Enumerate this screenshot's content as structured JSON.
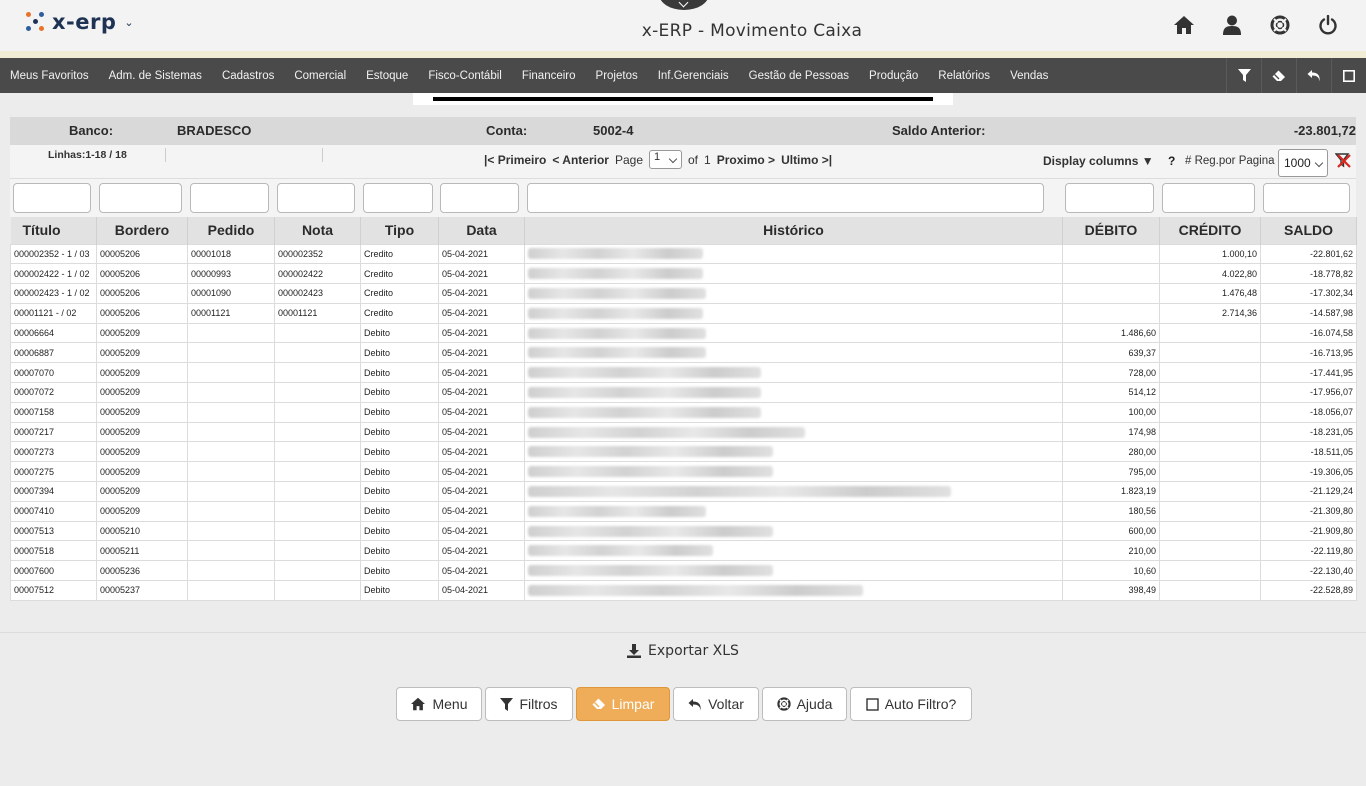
{
  "header": {
    "logo_text": "x-erp",
    "title": "x-ERP - Movimento Caixa",
    "icons": [
      "home-icon",
      "user-icon",
      "support-icon",
      "power-icon"
    ]
  },
  "menu": {
    "items": [
      "Meus Favoritos",
      "Adm. de Sistemas",
      "Cadastros",
      "Comercial",
      "Estoque",
      "Fisco-Contábil",
      "Financeiro",
      "Projetos",
      "Inf.Gerenciais",
      "Gestão de Pessoas",
      "Produção",
      "Relatórios",
      "Vendas"
    ],
    "tools": [
      "filter-icon",
      "eraser-icon",
      "undo-icon",
      "maximize-icon"
    ]
  },
  "info": {
    "banco_label": "Banco:",
    "banco_value": "BRADESCO",
    "conta_label": "Conta:",
    "conta_value": "5002-4",
    "saldo_label": "Saldo Anterior:",
    "saldo_value": "-23.801,72"
  },
  "pager": {
    "lines": "Linhas:1-18 / 18",
    "first": "|< Primeiro",
    "prev": "< Anterior",
    "page_label": "Page",
    "page_value": "1",
    "of_label": "of",
    "total_pages": "1",
    "next": "Proximo >",
    "last": "Ultimo >|",
    "display_columns": "Display columns",
    "help": "?",
    "rpp_label": "# Reg.por Pagina",
    "rpp_value": "1000"
  },
  "table": {
    "columns": [
      "Título",
      "Bordero",
      "Pedido",
      "Nota",
      "Tipo",
      "Data",
      "Histórico",
      "DÉBITO",
      "CRÉDITO",
      "SALDO"
    ],
    "rows": [
      {
        "titulo": "000002352 - 1 / 03",
        "bordero": "00005206",
        "pedido": "00001018",
        "nota": "000002352",
        "tipo": "Credito",
        "data": "05-04-2021",
        "debito": "",
        "credito": "1.000,10",
        "saldo": "-22.801,62",
        "hist_w": 175
      },
      {
        "titulo": "000002422 - 1 / 02",
        "bordero": "00005206",
        "pedido": "00000993",
        "nota": "000002422",
        "tipo": "Credito",
        "data": "05-04-2021",
        "debito": "",
        "credito": "4.022,80",
        "saldo": "-18.778,82",
        "hist_w": 175
      },
      {
        "titulo": "000002423 - 1 / 02",
        "bordero": "00005206",
        "pedido": "00001090",
        "nota": "000002423",
        "tipo": "Credito",
        "data": "05-04-2021",
        "debito": "",
        "credito": "1.476,48",
        "saldo": "-17.302,34",
        "hist_w": 178
      },
      {
        "titulo": "00001121 - / 02",
        "bordero": "00005206",
        "pedido": "00001121",
        "nota": "00001121",
        "tipo": "Credito",
        "data": "05-04-2021",
        "debito": "",
        "credito": "2.714,36",
        "saldo": "-14.587,98",
        "hist_w": 175
      },
      {
        "titulo": "00006664",
        "bordero": "00005209",
        "pedido": "",
        "nota": "",
        "tipo": "Debito",
        "data": "05-04-2021",
        "debito": "1.486,60",
        "credito": "",
        "saldo": "-16.074,58",
        "hist_w": 178
      },
      {
        "titulo": "00006887",
        "bordero": "00005209",
        "pedido": "",
        "nota": "",
        "tipo": "Debito",
        "data": "05-04-2021",
        "debito": "639,37",
        "credito": "",
        "saldo": "-16.713,95",
        "hist_w": 178
      },
      {
        "titulo": "00007070",
        "bordero": "00005209",
        "pedido": "",
        "nota": "",
        "tipo": "Debito",
        "data": "05-04-2021",
        "debito": "728,00",
        "credito": "",
        "saldo": "-17.441,95",
        "hist_w": 233
      },
      {
        "titulo": "00007072",
        "bordero": "00005209",
        "pedido": "",
        "nota": "",
        "tipo": "Debito",
        "data": "05-04-2021",
        "debito": "514,12",
        "credito": "",
        "saldo": "-17.956,07",
        "hist_w": 233
      },
      {
        "titulo": "00007158",
        "bordero": "00005209",
        "pedido": "",
        "nota": "",
        "tipo": "Debito",
        "data": "05-04-2021",
        "debito": "100,00",
        "credito": "",
        "saldo": "-18.056,07",
        "hist_w": 233
      },
      {
        "titulo": "00007217",
        "bordero": "00005209",
        "pedido": "",
        "nota": "",
        "tipo": "Debito",
        "data": "05-04-2021",
        "debito": "174,98",
        "credito": "",
        "saldo": "-18.231,05",
        "hist_w": 277
      },
      {
        "titulo": "00007273",
        "bordero": "00005209",
        "pedido": "",
        "nota": "",
        "tipo": "Debito",
        "data": "05-04-2021",
        "debito": "280,00",
        "credito": "",
        "saldo": "-18.511,05",
        "hist_w": 245
      },
      {
        "titulo": "00007275",
        "bordero": "00005209",
        "pedido": "",
        "nota": "",
        "tipo": "Debito",
        "data": "05-04-2021",
        "debito": "795,00",
        "credito": "",
        "saldo": "-19.306,05",
        "hist_w": 245
      },
      {
        "titulo": "00007394",
        "bordero": "00005209",
        "pedido": "",
        "nota": "",
        "tipo": "Debito",
        "data": "05-04-2021",
        "debito": "1.823,19",
        "credito": "",
        "saldo": "-21.129,24",
        "hist_w": 423
      },
      {
        "titulo": "00007410",
        "bordero": "00005209",
        "pedido": "",
        "nota": "",
        "tipo": "Debito",
        "data": "05-04-2021",
        "debito": "180,56",
        "credito": "",
        "saldo": "-21.309,80",
        "hist_w": 178
      },
      {
        "titulo": "00007513",
        "bordero": "00005210",
        "pedido": "",
        "nota": "",
        "tipo": "Debito",
        "data": "05-04-2021",
        "debito": "600,00",
        "credito": "",
        "saldo": "-21.909,80",
        "hist_w": 245
      },
      {
        "titulo": "00007518",
        "bordero": "00005211",
        "pedido": "",
        "nota": "",
        "tipo": "Debito",
        "data": "05-04-2021",
        "debito": "210,00",
        "credito": "",
        "saldo": "-22.119,80",
        "hist_w": 185
      },
      {
        "titulo": "00007600",
        "bordero": "00005236",
        "pedido": "",
        "nota": "",
        "tipo": "Debito",
        "data": "05-04-2021",
        "debito": "10,60",
        "credito": "",
        "saldo": "-22.130,40",
        "hist_w": 245
      },
      {
        "titulo": "00007512",
        "bordero": "00005237",
        "pedido": "",
        "nota": "",
        "tipo": "Debito",
        "data": "05-04-2021",
        "debito": "398,49",
        "credito": "",
        "saldo": "-22.528,89",
        "hist_w": 335
      }
    ]
  },
  "actions": {
    "export": "Exportar XLS",
    "menu": "Menu",
    "filtros": "Filtros",
    "limpar": "Limpar",
    "voltar": "Voltar",
    "ajuda": "Ajuda",
    "auto_filtro": "Auto Filtro?"
  },
  "colors": {
    "menubar": "#4a4a4a",
    "primary_button": "#efad59",
    "logo": "#1e3354"
  }
}
